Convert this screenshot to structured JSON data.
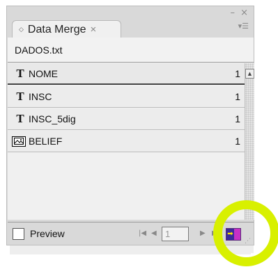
{
  "panel": {
    "tab_label": "Data Merge",
    "tab_close_glyph": "×",
    "tab_diamond_glyph": "◇",
    "window_controls": "– ×",
    "panel_menu_glyph": "▾☰"
  },
  "data_source": {
    "file_name": "DADOS.txt"
  },
  "fields": [
    {
      "type": "text",
      "type_glyph": "T",
      "name": "NOME",
      "count": "1",
      "selected": true
    },
    {
      "type": "text",
      "type_glyph": "T",
      "name": "INSC",
      "count": "1",
      "selected": false
    },
    {
      "type": "text",
      "type_glyph": "T",
      "name": "INSC_5dig",
      "count": "1",
      "selected": false
    },
    {
      "type": "image",
      "type_glyph": "",
      "name": "BELIEF",
      "count": "1",
      "selected": false
    }
  ],
  "footer": {
    "preview_label": "Preview",
    "preview_checked": false,
    "record_number": "1",
    "first_glyph": "|◀",
    "prev_glyph": "◀",
    "next_glyph": "▶",
    "last_glyph": "▶|",
    "create_glyph": "➡"
  },
  "icons": {
    "text_field": "T",
    "image_field": "image-placeholder-icon",
    "scroll_up": "▲",
    "create_merged_document": "create-merged-document-icon"
  },
  "colors": {
    "panel_bg": "#d9d9d9",
    "list_bg": "#f0f0f0",
    "highlight": "#d8f000",
    "create_button_arrow": "#3a2a9a",
    "create_button_doc": "#c62fc6"
  }
}
